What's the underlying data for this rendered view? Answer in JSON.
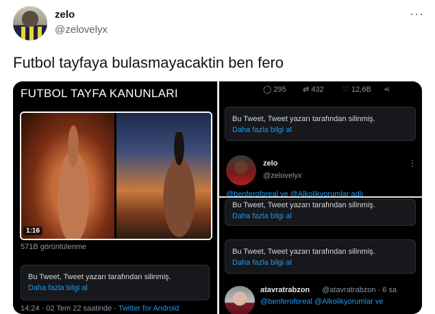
{
  "tweet": {
    "author_name": "zelo",
    "author_handle": "@zelovelyx",
    "more_glyph": "···",
    "text": "Futbol tayfaya bulasmayacaktin ben fero"
  },
  "media": {
    "left": {
      "title": "FUTBOL TAYFA KANUNLARI",
      "video_time": "1:16",
      "views": "571B görüntülenme",
      "deleted_msg": "Bu Tweet, Tweet yazarı tarafından silinmiş.",
      "deleted_link": "Daha fazla bilgi al",
      "timestamp": "14:24 · 02 Tem 22 saatinde ·",
      "source": "Twitter for Android"
    },
    "right": {
      "actions": {
        "reply_count": "295",
        "retweet_count": "432",
        "like_count": "12,6B"
      },
      "deleted_msg": "Bu Tweet, Tweet yazarı tarafından silinmiş.",
      "deleted_link": "Daha fazla bilgi al",
      "reply_user": {
        "name": "zelo",
        "handle": "@zelovelyx",
        "mention_partial": "@benferoforeal ve @Alkolikyorumlar adlı"
      },
      "bottom_user": {
        "name": "atavratrabzon",
        "handle": "@atavratrabzon · 6 sa",
        "mentions": "@benferoforeal @Alkolikyorumlar ve",
        "more_glyph": "⋮"
      }
    }
  }
}
